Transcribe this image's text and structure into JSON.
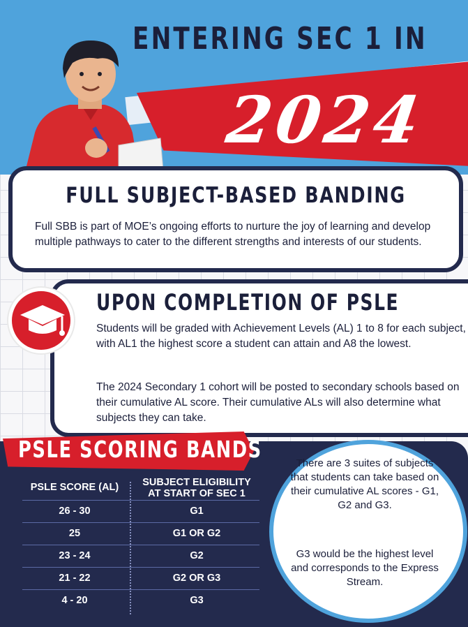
{
  "header": {
    "title": "ENTERING SEC 1 IN",
    "year": "2024"
  },
  "sbb": {
    "heading": "FULL SUBJECT-BASED BANDING",
    "body": "Full SBB is part of MOE’s ongoing efforts to nurture the joy of learning and develop multiple pathways to cater to the different strengths and interests of our students."
  },
  "psle": {
    "heading": "UPON COMPLETION OF PSLE",
    "para1": "Students will be graded with Achievement Levels (AL) 1 to 8 for each subject, with AL1 the highest score a student can attain and A8 the lowest.",
    "para2": "The 2024 Secondary 1 cohort will be posted to secondary schools based on their cumulative AL score. Their cumulative ALs will also determine what subjects they can take."
  },
  "bands": {
    "title": "PSLE SCORING BANDS",
    "col1": "PSLE SCORE (AL)",
    "col2_line1": "SUBJECT ELIGIBILITY",
    "col2_line2": "AT START OF SEC 1",
    "rows": [
      {
        "score": "26 - 30",
        "subject": "G1"
      },
      {
        "score": "25",
        "subject": "G1 OR G2"
      },
      {
        "score": "23 - 24",
        "subject": "G2"
      },
      {
        "score": "21 - 22",
        "subject": "G2 OR G3"
      },
      {
        "score": "4 - 20",
        "subject": "G3"
      }
    ]
  },
  "note": {
    "para1": "There are 3 suites of subjects that students can take based on their cumulative AL scores - G1, G2 and G3.",
    "para2": "G3 would be the highest level and corresponds to the Express Stream."
  },
  "colors": {
    "navy": "#232a4d",
    "red": "#d71f2b",
    "sky": "#4fa3dc"
  },
  "icons": [
    "student-illustration",
    "graduation-cap-icon"
  ]
}
